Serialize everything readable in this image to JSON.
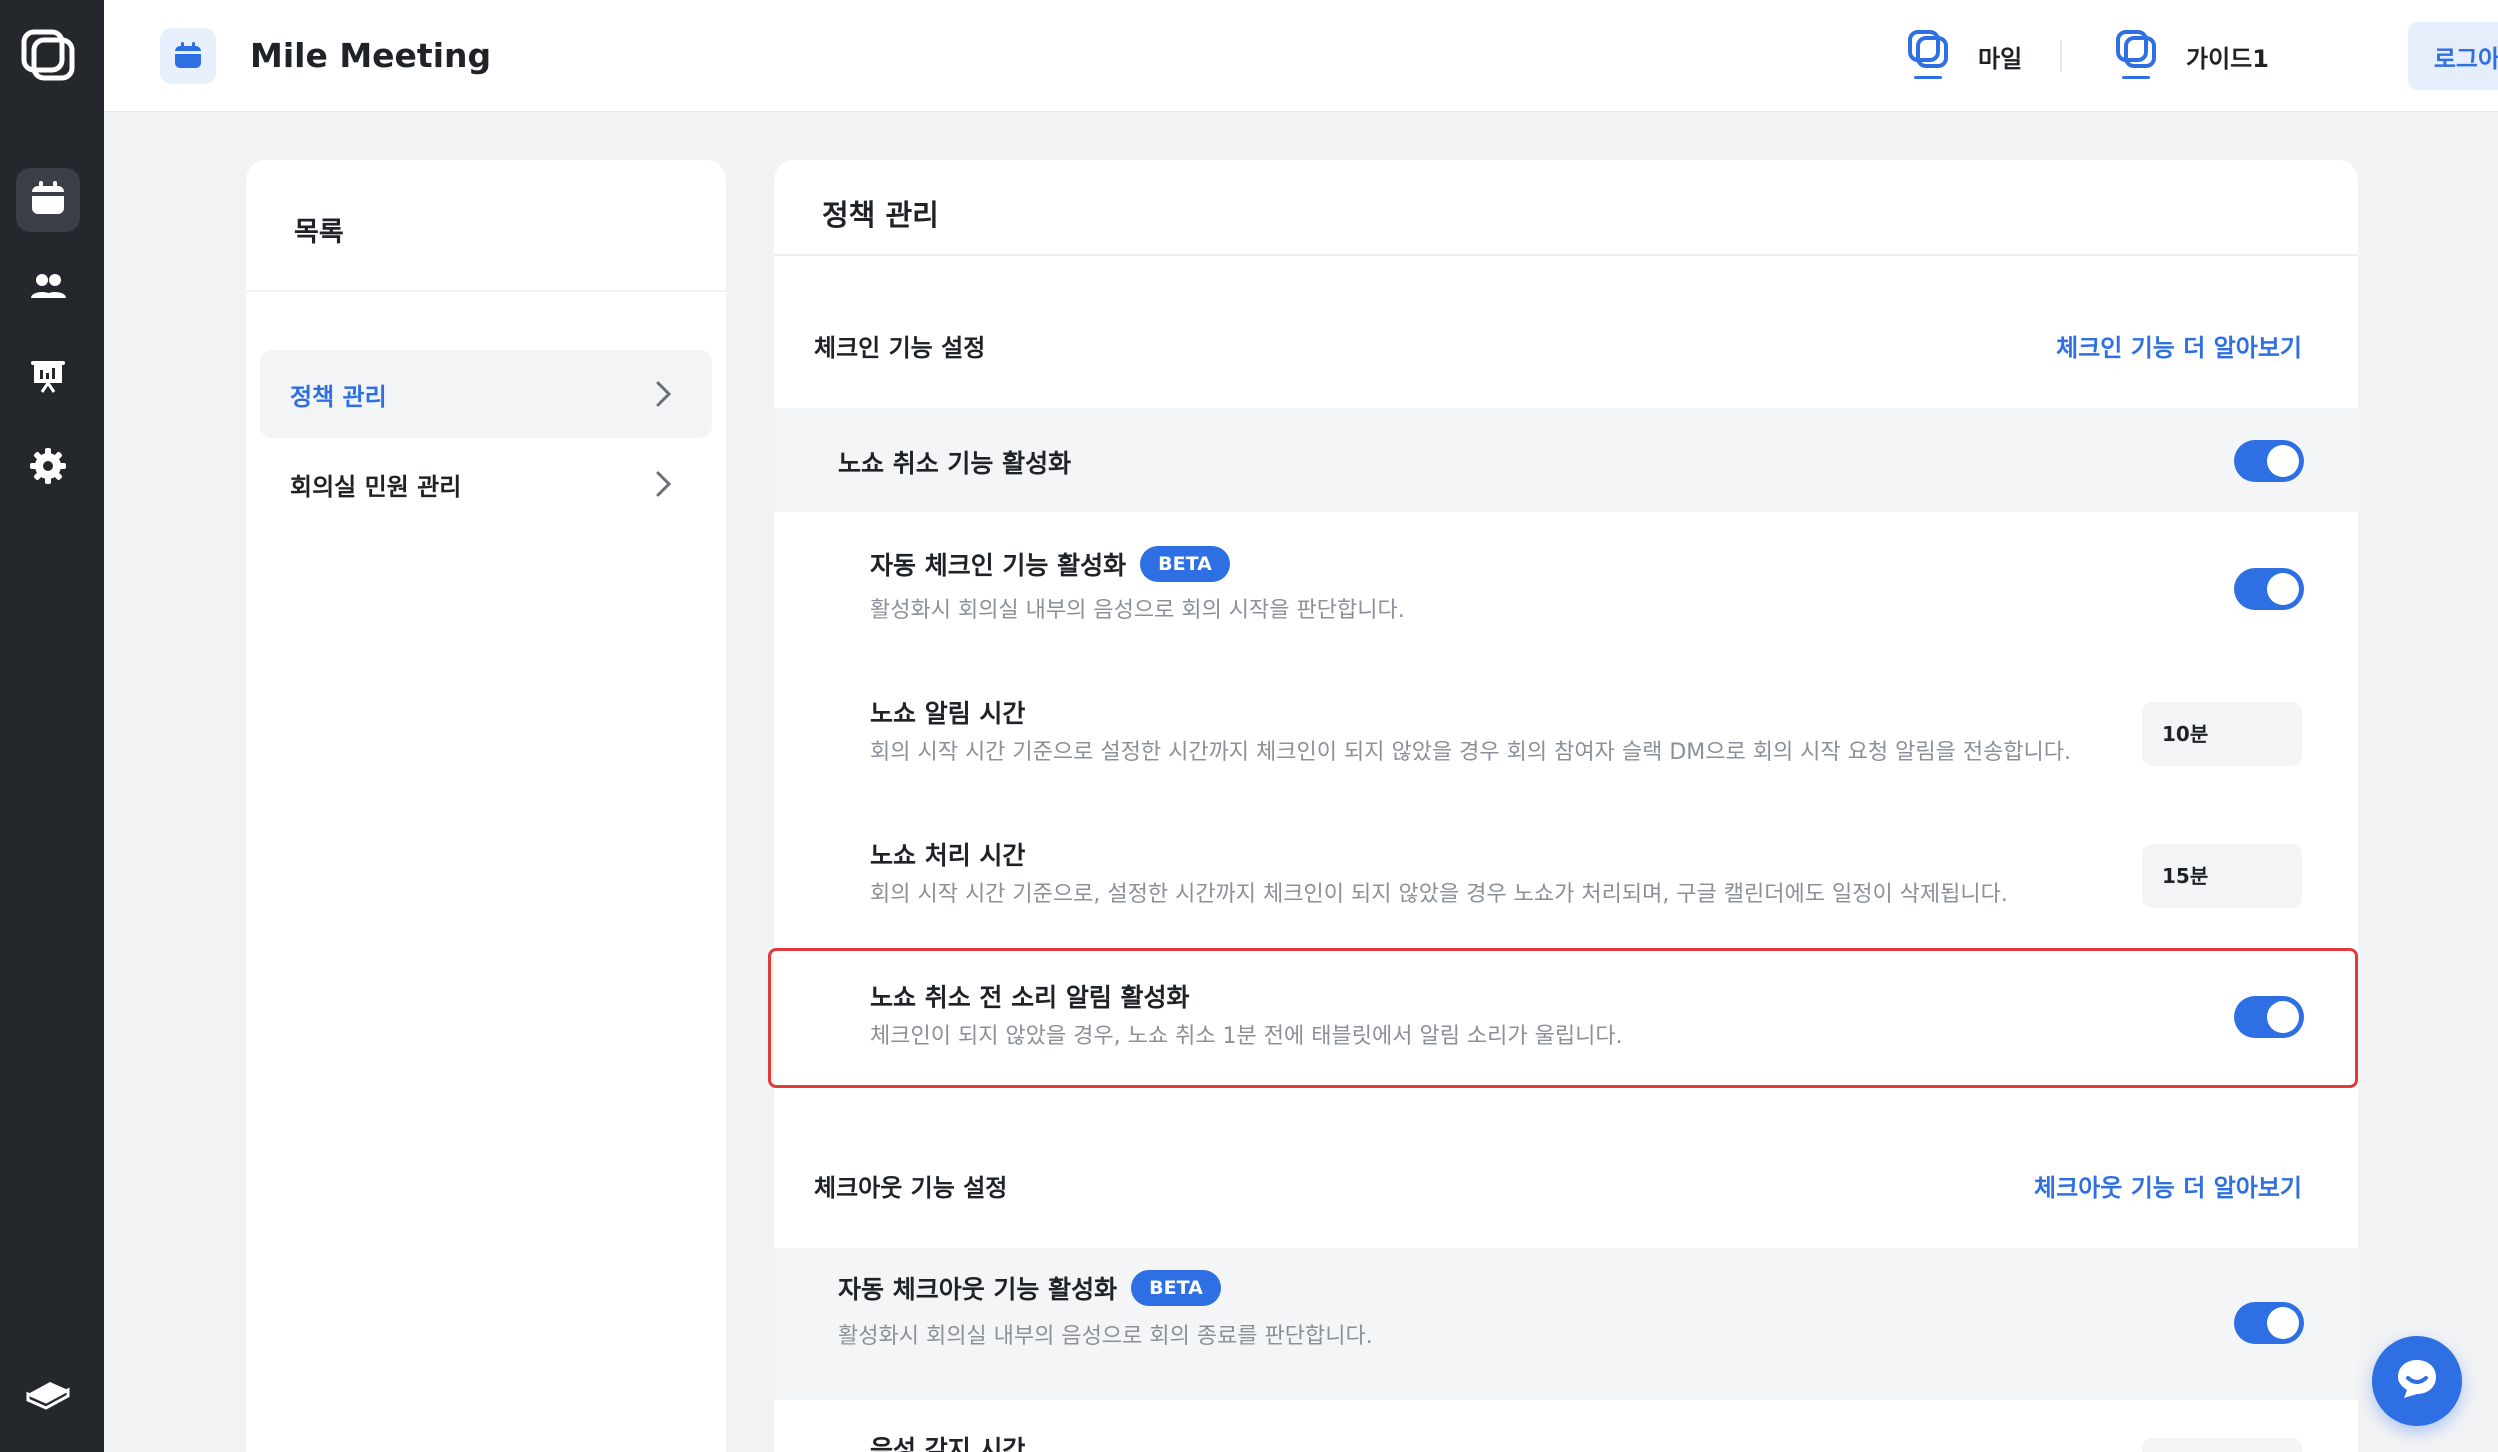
{
  "colors": {
    "accent": "#2f6fe4",
    "rail": "#24272b",
    "highlight": "#e23b3b"
  },
  "header": {
    "app_title": "Mile Meeting",
    "workspace_name": "마일",
    "user_name": "가이드1",
    "logout_label": "로그아웃"
  },
  "nav": {
    "icons": [
      "calendar-icon",
      "people-icon",
      "presentation-icon",
      "settings-icon",
      "book-icon"
    ]
  },
  "list": {
    "title": "목록",
    "items": [
      {
        "label": "정책 관리",
        "active": true
      },
      {
        "label": "회의실 민원 관리",
        "active": false
      }
    ]
  },
  "main": {
    "title": "정책 관리",
    "checkin": {
      "title": "체크인 기능 설정",
      "link": "체크인 기능 더 알아보기",
      "noshow_cancel": {
        "label": "노쇼 취소 기능 활성화",
        "enabled": true
      },
      "auto_checkin": {
        "label": "자동 체크인 기능 활성화",
        "badge": "BETA",
        "desc": "활성화시 회의실 내부의 음성으로 회의 시작을 판단합니다.",
        "enabled": true
      },
      "noshow_alert_time": {
        "label": "노쇼 알림 시간",
        "desc": "회의 시작 시간 기준으로 설정한 시간까지 체크인이 되지 않았을 경우 회의 참여자 슬랙 DM으로 회의 시작 요청 알림을 전송합니다.",
        "value": "10분"
      },
      "noshow_process_time": {
        "label": "노쇼 처리 시간",
        "desc": "회의 시작 시간 기준으로, 설정한 시간까지 체크인이 되지 않았을 경우 노쇼가 처리되며, 구글 캘린더에도 일정이 삭제됩니다.",
        "value": "15분"
      },
      "sound_alert": {
        "label": "노쇼 취소 전 소리 알림 활성화",
        "desc": "체크인이 되지 않았을 경우, 노쇼 취소 1분 전에 태블릿에서 알림 소리가 울립니다.",
        "enabled": true
      }
    },
    "checkout": {
      "title": "체크아웃 기능 설정",
      "link": "체크아웃 기능 더 알아보기",
      "auto_checkout": {
        "label": "자동 체크아웃 기능 활성화",
        "badge": "BETA",
        "desc": "활성화시 회의실 내부의 음성으로 회의 종료를 판단합니다.",
        "enabled": true
      },
      "voice_detect_time": {
        "label": "음성 감지 시간"
      }
    }
  }
}
